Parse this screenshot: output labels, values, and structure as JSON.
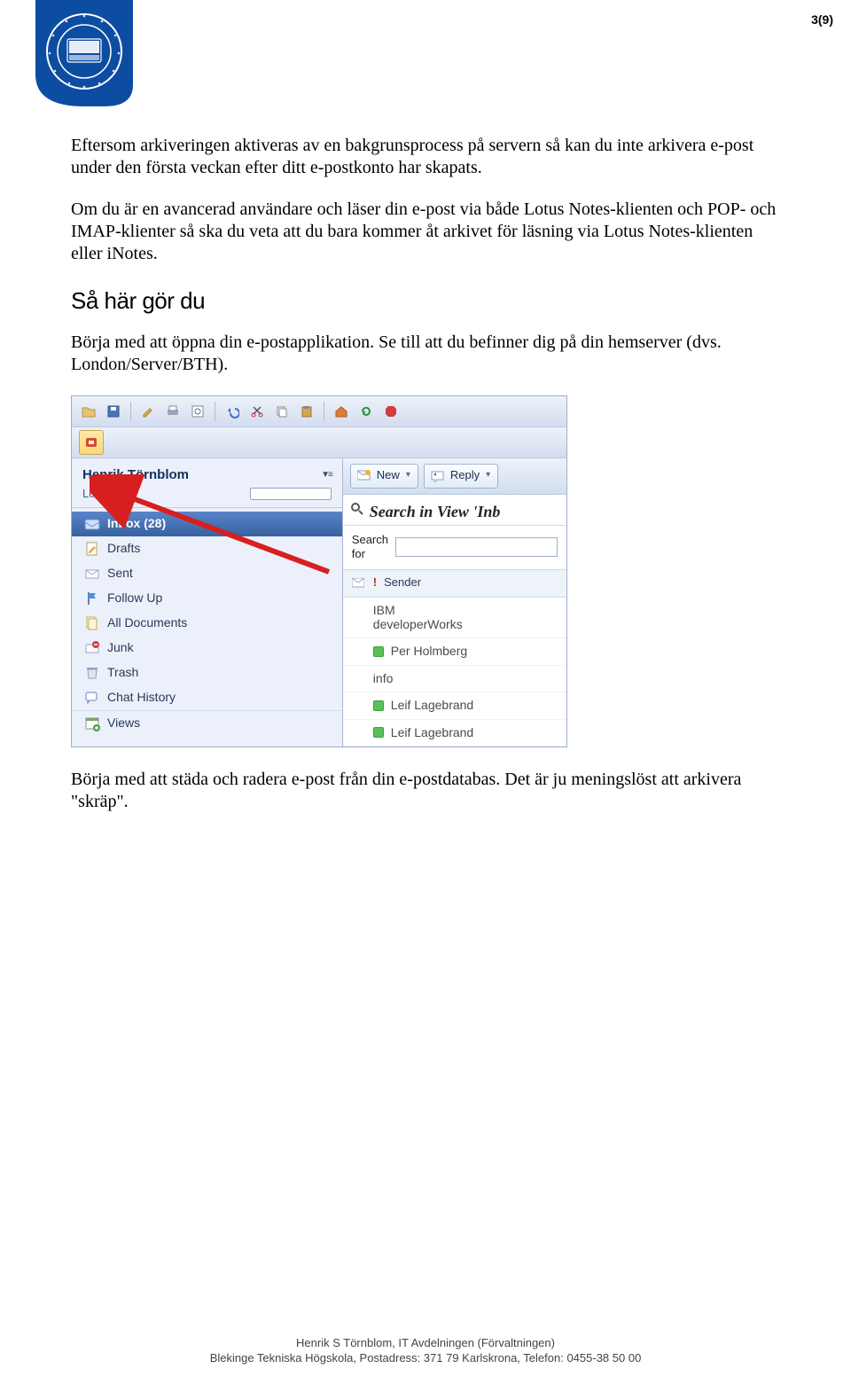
{
  "page": {
    "num": "3(9)"
  },
  "para1": "Eftersom arkiveringen aktiveras av en bakgrunsprocess på servern så kan du inte arkivera e-post under den första veckan efter ditt e-postkonto har skapats.",
  "para2": "Om du är en avancerad användare och läser din e-post via både Lotus Notes-klienten och POP- och IMAP-klienter så ska du veta att du bara kommer åt arkivet för läsning via Lotus Notes-klienten eller iNotes.",
  "heading": "Så här gör du",
  "para3": "Börja med att öppna din e-postapplikation. Se till att du befinner dig på din hemserver (dvs. London/Server/BTH).",
  "para4": "Börja med att städa och radera e-post från din e-postdatabas. Det är ju meningslöst att arkivera \"skräp\".",
  "footer": {
    "line1": "Henrik S Törnblom, IT Avdelningen (Förvaltningen)",
    "line2": "Blekinge Tekniska Högskola, Postadress: 371 79 Karlskrona, Telefon: 0455-38 50 00"
  },
  "app": {
    "user_name": "Henrik Törnblom",
    "server": "London",
    "sidebar": {
      "items": [
        {
          "label": "Inbox (28)",
          "icon": "inbox-icon",
          "selected": true
        },
        {
          "label": "Drafts",
          "icon": "drafts-icon",
          "selected": false
        },
        {
          "label": "Sent",
          "icon": "sent-icon",
          "selected": false
        },
        {
          "label": "Follow Up",
          "icon": "flag-icon",
          "selected": false
        },
        {
          "label": "All Documents",
          "icon": "all-docs-icon",
          "selected": false
        },
        {
          "label": "Junk",
          "icon": "junk-icon",
          "selected": false
        },
        {
          "label": "Trash",
          "icon": "trash-icon",
          "selected": false
        },
        {
          "label": "Chat History",
          "icon": "chat-icon",
          "selected": false
        },
        {
          "label": "Views",
          "icon": "views-icon",
          "selected": false
        }
      ]
    },
    "actions": {
      "new_label": "New",
      "reply_label": "Reply"
    },
    "search": {
      "title": "Search in View 'Inb",
      "label": "Search for",
      "value": ""
    },
    "table": {
      "header": "Sender",
      "rows": [
        {
          "sender": "IBM developerWorks",
          "multiline": true,
          "presence": false
        },
        {
          "sender": "Per Holmberg",
          "presence": true
        },
        {
          "sender": "info",
          "presence": false
        },
        {
          "sender": "Leif Lagebrand",
          "presence": true
        },
        {
          "sender": "Leif Lagebrand",
          "presence": true
        }
      ]
    }
  }
}
